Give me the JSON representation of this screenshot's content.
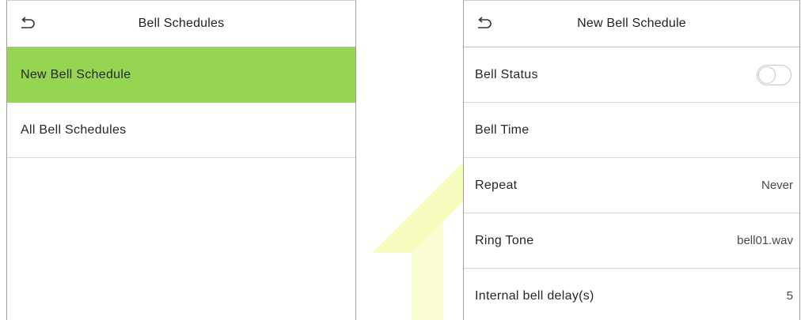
{
  "colors": {
    "selected_row": "#96d552",
    "watermark": "#e6f542",
    "divider": "#d7d7d7"
  },
  "left_panel": {
    "back_icon": "back-arrow-icon",
    "title": "Bell Schedules",
    "items": [
      {
        "label": "New Bell Schedule",
        "selected": true
      },
      {
        "label": "All Bell Schedules",
        "selected": false
      }
    ]
  },
  "right_panel": {
    "back_icon": "back-arrow-icon",
    "title": "New Bell Schedule",
    "rows": {
      "bell_status": {
        "label": "Bell Status",
        "toggle_on": false
      },
      "bell_time": {
        "label": "Bell Time",
        "value": ""
      },
      "repeat": {
        "label": "Repeat",
        "value": "Never"
      },
      "ring_tone": {
        "label": "Ring Tone",
        "value": "bell01.wav"
      },
      "internal_delay": {
        "label": "Internal bell delay(s)",
        "value": "5"
      }
    }
  }
}
